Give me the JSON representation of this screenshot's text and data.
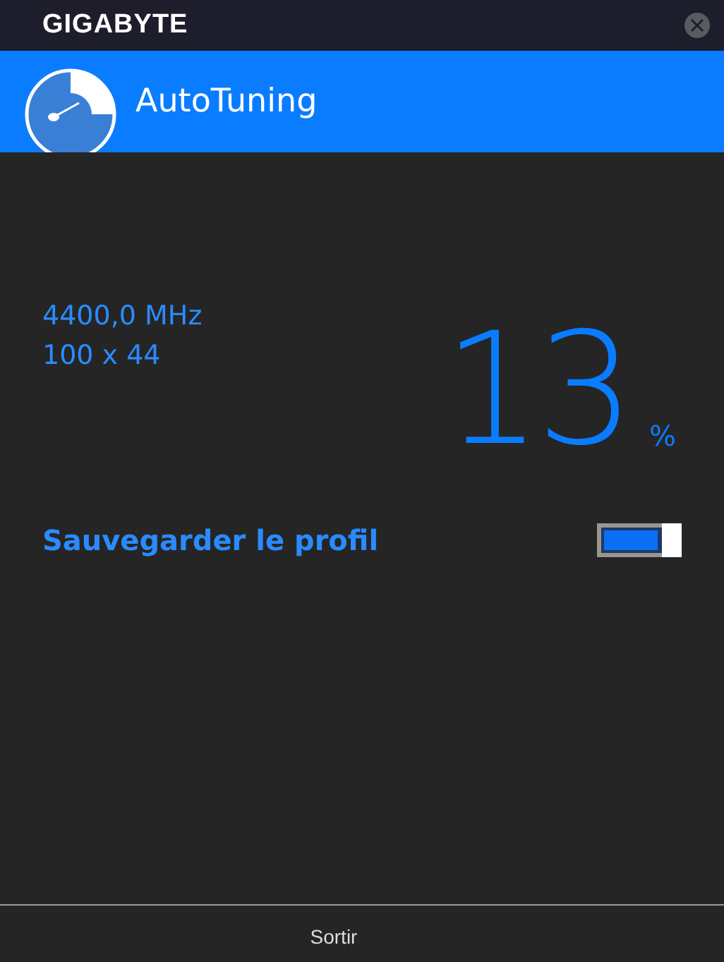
{
  "window": {
    "title": "GIGABYTE"
  },
  "header": {
    "title": "AutoTuning"
  },
  "readings": [
    "4400,0 MHz",
    "100 x 44"
  ],
  "progress": {
    "value": "13",
    "unit": "%"
  },
  "save_profile": {
    "label": "Sauvegarder le profil",
    "on": true
  },
  "footer": {
    "exit_label": "Sortir"
  }
}
